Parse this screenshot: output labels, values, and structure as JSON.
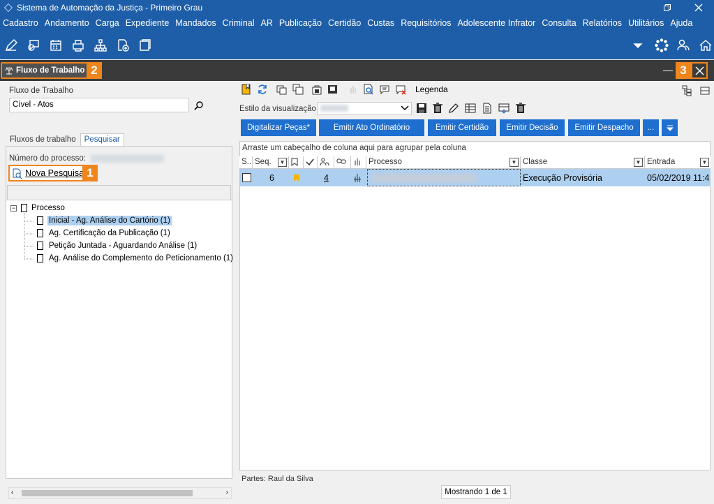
{
  "window": {
    "title": "Sistema de Automação da Justiça - Primeiro Grau"
  },
  "menu": [
    "Cadastro",
    "Andamento",
    "Carga",
    "Expediente",
    "Mandados",
    "Criminal",
    "AR",
    "Publicação",
    "Certidão",
    "Custas",
    "Requisitórios",
    "Adolescente Infrator",
    "Consulta",
    "Relatórios",
    "Utilitários",
    "Ajuda"
  ],
  "panel": {
    "title": "Fluxo de Trabalho",
    "num2": "2",
    "num3": "3"
  },
  "left": {
    "fluxo_label": "Fluxo de Trabalho",
    "fluxo_value": "Cível - Atos",
    "tabs": [
      "Fluxos de trabalho",
      "Pesquisar"
    ],
    "numero_label": "Número do processo:",
    "nova_pesquisa": "Nova Pesquisa",
    "num1": "1",
    "tree_root": "Processo",
    "tree_items": [
      "Inicial - Ag. Análise do Cartório (1)",
      "Ag. Certificação da Publicação (1)",
      "Petição Juntada - Aguardando Análise (1)",
      "Ag. Análise do Complemento do Peticionamento (1)"
    ]
  },
  "right": {
    "legenda": "Legenda",
    "estilo_label": "Estilo da visualização",
    "buttons": [
      "Digitalizar Peças*",
      "Emitir Ato Ordinatório",
      "Emitir Certidão",
      "Emitir Decisão",
      "Emitir Despacho",
      "..."
    ],
    "group_hint": "Arraste um cabeçalho de coluna aqui para agrupar pela coluna",
    "columns": {
      "s": "S...",
      "seq": "Seq.",
      "processo": "Processo",
      "classe": "Classe",
      "entrada": "Entrada"
    },
    "row": {
      "seq": "6",
      "qty": "4",
      "classe": "Execução Provisória",
      "entrada": "05/02/2019 11:4"
    },
    "partes": "Partes: Raul da Silva",
    "mostrando": "Mostrando 1 de 1"
  },
  "colors": {
    "brand": "#1e5ea8",
    "accent": "#f0851c",
    "button": "#1e6fd0",
    "selection": "#aed0f0"
  }
}
